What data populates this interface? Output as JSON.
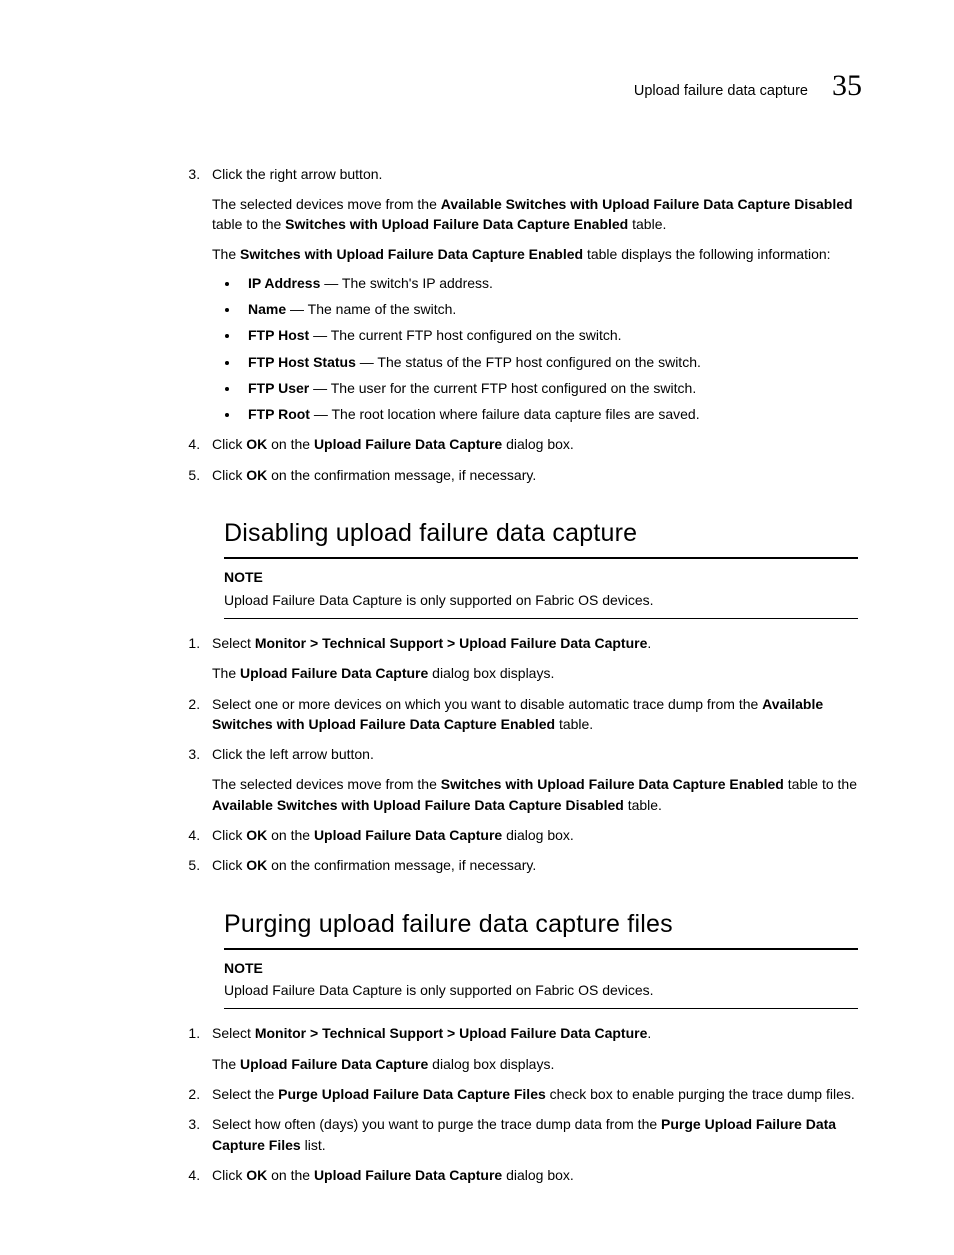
{
  "header": {
    "title": "Upload failure data capture",
    "chapter": "35"
  },
  "section1": {
    "step3": {
      "num": "3.",
      "text": "Click the right arrow button.",
      "p1_a": "The selected devices move from the ",
      "p1_b": "Available Switches with Upload Failure Data Capture Disabled",
      "p1_c": " table to the ",
      "p1_d": "Switches with Upload Failure Data Capture Enabled",
      "p1_e": " table.",
      "p2_a": "The ",
      "p2_b": "Switches with Upload Failure Data Capture Enabled",
      "p2_c": " table displays the following information:"
    },
    "bullets": {
      "b1_a": "IP Address",
      "b1_b": " — The switch's IP address.",
      "b2_a": "Name",
      "b2_b": " — The name of the switch.",
      "b3_a": "FTP Host",
      "b3_b": " — The current FTP host configured on the switch.",
      "b4_a": "FTP Host Status",
      "b4_b": " — The status of the FTP host configured on the switch.",
      "b5_a": "FTP User",
      "b5_b": " — The user for the current FTP host configured on the switch.",
      "b6_a": "FTP Root",
      "b6_b": " — The root location where failure data capture files are saved."
    },
    "step4": {
      "a": "Click ",
      "b": "OK",
      "c": " on the ",
      "d": "Upload Failure Data Capture",
      "e": " dialog box."
    },
    "step5": {
      "a": "Click ",
      "b": "OK",
      "c": " on the confirmation message, if necessary."
    }
  },
  "section2": {
    "heading": "Disabling upload failure data capture",
    "note_label": "NOTE",
    "note_text": "Upload Failure Data Capture is only supported on Fabric OS devices.",
    "step1": {
      "a": "Select ",
      "b": "Monitor > Technical Support > Upload Failure Data Capture",
      "c": ".",
      "p_a": "The ",
      "p_b": "Upload Failure Data Capture",
      "p_c": " dialog box displays."
    },
    "step2": {
      "a": "Select one or more devices on which you want to disable automatic trace dump from the ",
      "b": "Available Switches with Upload Failure Data Capture Enabled",
      "c": " table."
    },
    "step3": {
      "a": "Click the left arrow button.",
      "p_a": "The selected devices move from the ",
      "p_b": "Switches with Upload Failure Data Capture Enabled",
      "p_c": " table to the ",
      "p_d": "Available Switches with Upload Failure Data Capture Disabled",
      "p_e": " table."
    },
    "step4": {
      "a": "Click ",
      "b": "OK",
      "c": " on the ",
      "d": "Upload Failure Data Capture",
      "e": " dialog box."
    },
    "step5": {
      "a": "Click ",
      "b": "OK",
      "c": " on the confirmation message, if necessary."
    }
  },
  "section3": {
    "heading": "Purging upload failure data capture files",
    "note_label": "NOTE",
    "note_text": "Upload Failure Data Capture is only supported on Fabric OS devices.",
    "step1": {
      "a": "Select ",
      "b": "Monitor > Technical Support > Upload Failure Data Capture",
      "c": ".",
      "p_a": "The ",
      "p_b": "Upload Failure Data Capture",
      "p_c": " dialog box displays."
    },
    "step2": {
      "a": "Select the ",
      "b": "Purge Upload Failure Data Capture Files",
      "c": " check box to enable purging the trace dump files."
    },
    "step3": {
      "a": "Select how often (days) you want to purge the trace dump data from the ",
      "b": "Purge Upload Failure Data Capture Files",
      "c": " list."
    },
    "step4": {
      "a": "Click ",
      "b": "OK",
      "c": " on the ",
      "d": "Upload Failure Data Capture",
      "e": " dialog box."
    }
  }
}
